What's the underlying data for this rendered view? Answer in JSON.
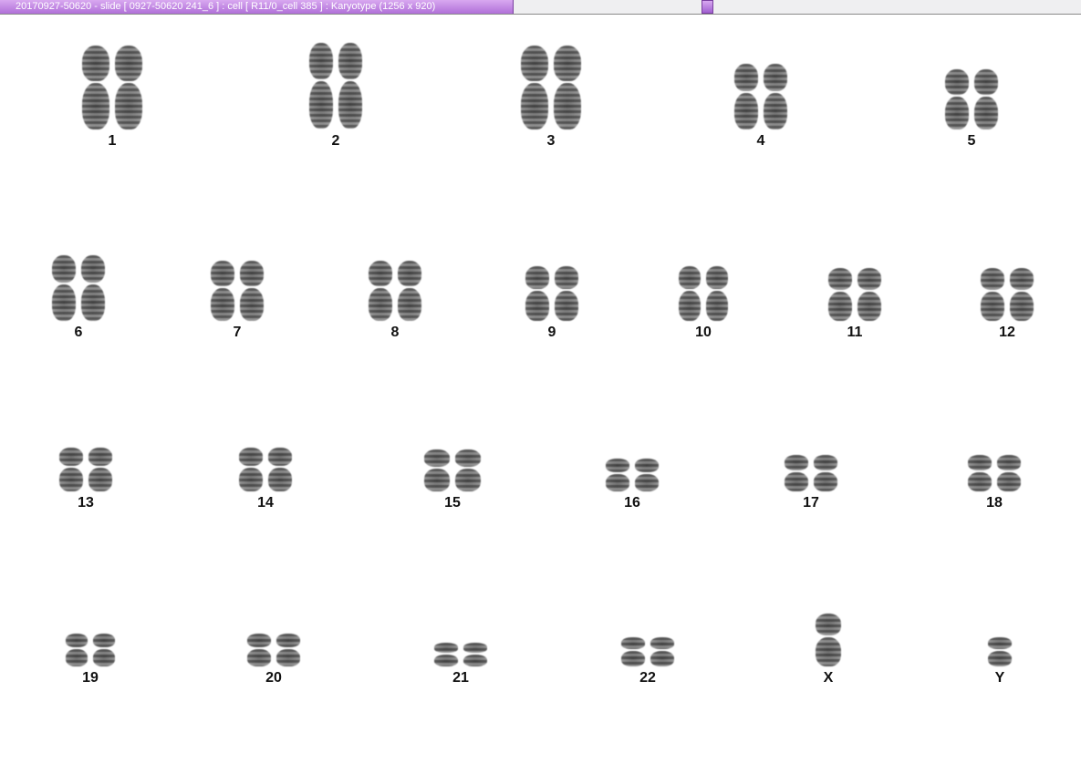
{
  "window": {
    "title": "20170927-50620 - slide [ 0927-50620 241_6 ] : cell [ R11/0_cell 385 ] : Karyotype  (1256 x 920)"
  },
  "karyotype": {
    "chromosomes": [
      {
        "label": "1"
      },
      {
        "label": "2"
      },
      {
        "label": "3"
      },
      {
        "label": "4"
      },
      {
        "label": "5"
      },
      {
        "label": "6"
      },
      {
        "label": "7"
      },
      {
        "label": "8"
      },
      {
        "label": "9"
      },
      {
        "label": "10"
      },
      {
        "label": "11"
      },
      {
        "label": "12"
      },
      {
        "label": "13"
      },
      {
        "label": "14"
      },
      {
        "label": "15"
      },
      {
        "label": "16"
      },
      {
        "label": "17"
      },
      {
        "label": "18"
      },
      {
        "label": "19"
      },
      {
        "label": "20"
      },
      {
        "label": "21"
      },
      {
        "label": "22"
      },
      {
        "label": "X"
      },
      {
        "label": "Y"
      }
    ]
  }
}
